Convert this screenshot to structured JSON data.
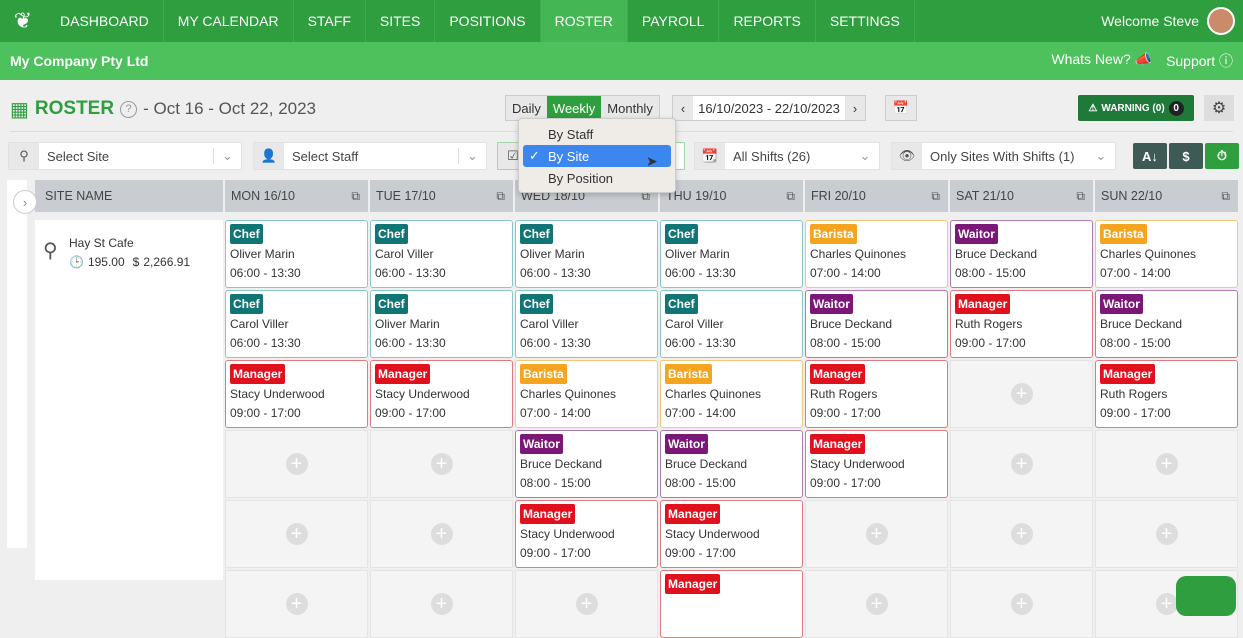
{
  "nav": {
    "items": [
      "DASHBOARD",
      "MY CALENDAR",
      "STAFF",
      "SITES",
      "POSITIONS",
      "ROSTER",
      "PAYROLL",
      "REPORTS",
      "SETTINGS"
    ],
    "active": "ROSTER",
    "welcome": "Welcome Steve"
  },
  "subbar": {
    "company": "My Company Pty Ltd",
    "whats_new": "Whats New?",
    "support": "Support"
  },
  "title": {
    "label": "ROSTER",
    "help": "?",
    "range": "- Oct 16 - Oct 22, 2023"
  },
  "view": {
    "options": [
      "Daily",
      "Weekly",
      "Monthly"
    ],
    "active": "Weekly"
  },
  "date_nav": {
    "prev": "‹",
    "value": "16/10/2023 - 22/10/2023",
    "next": "›"
  },
  "warning": {
    "label": "WARNING (0)",
    "count": "0"
  },
  "filters": {
    "site": "Select Site",
    "staff": "Select Staff",
    "shifts": "All Shifts (26)",
    "visibility": "Only Sites With Shifts (1)"
  },
  "group_menu": {
    "items": [
      "By Staff",
      "By Site",
      "By Position"
    ],
    "selected": "By Site"
  },
  "buttons": {
    "sort": "A↓",
    "cost": "$",
    "time": "⏱"
  },
  "colors": {
    "Chef": "#127575",
    "Barista": "#f5a41f",
    "Waitor": "#7a1777",
    "Manager": "#e0111c"
  },
  "grid": {
    "site_header": "SITE NAME",
    "site": {
      "name": "Hay St Cafe",
      "hours": "195.00",
      "cost": "2,266.91"
    },
    "days": [
      {
        "label": "MON 16/10",
        "shifts": [
          [
            "Chef",
            "Oliver Marin",
            "06:00 - 13:30"
          ],
          [
            "Chef",
            "Carol Viller",
            "06:00 - 13:30"
          ],
          [
            "Manager",
            "Stacy Underwood",
            "09:00 - 17:00"
          ]
        ]
      },
      {
        "label": "TUE 17/10",
        "shifts": [
          [
            "Chef",
            "Carol Viller",
            "06:00 - 13:30"
          ],
          [
            "Chef",
            "Oliver Marin",
            "06:00 - 13:30"
          ],
          [
            "Manager",
            "Stacy Underwood",
            "09:00 - 17:00"
          ]
        ]
      },
      {
        "label": "WED 18/10",
        "shifts": [
          [
            "Chef",
            "Oliver Marin",
            "06:00 - 13:30"
          ],
          [
            "Chef",
            "Carol Viller",
            "06:00 - 13:30"
          ],
          [
            "Barista",
            "Charles Quinones",
            "07:00 - 14:00"
          ],
          [
            "Waitor",
            "Bruce Deckand",
            "08:00 - 15:00"
          ],
          [
            "Manager",
            "Stacy Underwood",
            "09:00 - 17:00"
          ]
        ]
      },
      {
        "label": "THU 19/10",
        "shifts": [
          [
            "Chef",
            "Oliver Marin",
            "06:00 - 13:30"
          ],
          [
            "Chef",
            "Carol Viller",
            "06:00 - 13:30"
          ],
          [
            "Barista",
            "Charles Quinones",
            "07:00 - 14:00"
          ],
          [
            "Waitor",
            "Bruce Deckand",
            "08:00 - 15:00"
          ],
          [
            "Manager",
            "Stacy Underwood",
            "09:00 - 17:00"
          ],
          [
            "Manager",
            "",
            ""
          ]
        ]
      },
      {
        "label": "FRI 20/10",
        "shifts": [
          [
            "Barista",
            "Charles Quinones",
            "07:00 - 14:00"
          ],
          [
            "Waitor",
            "Bruce Deckand",
            "08:00 - 15:00"
          ],
          [
            "Manager",
            "Ruth Rogers",
            "09:00 - 17:00"
          ],
          [
            "Manager",
            "Stacy Underwood",
            "09:00 - 17:00"
          ]
        ]
      },
      {
        "label": "SAT 21/10",
        "shifts": [
          [
            "Waitor",
            "Bruce Deckand",
            "08:00 - 15:00"
          ],
          [
            "Manager",
            "Ruth Rogers",
            "09:00 - 17:00"
          ]
        ]
      },
      {
        "label": "SUN 22/10",
        "shifts": [
          [
            "Barista",
            "Charles Quinones",
            "07:00 - 14:00"
          ],
          [
            "Waitor",
            "Bruce Deckand",
            "08:00 - 15:00"
          ],
          [
            "Manager",
            "Ruth Rogers",
            "09:00 - 17:00"
          ]
        ]
      }
    ]
  }
}
